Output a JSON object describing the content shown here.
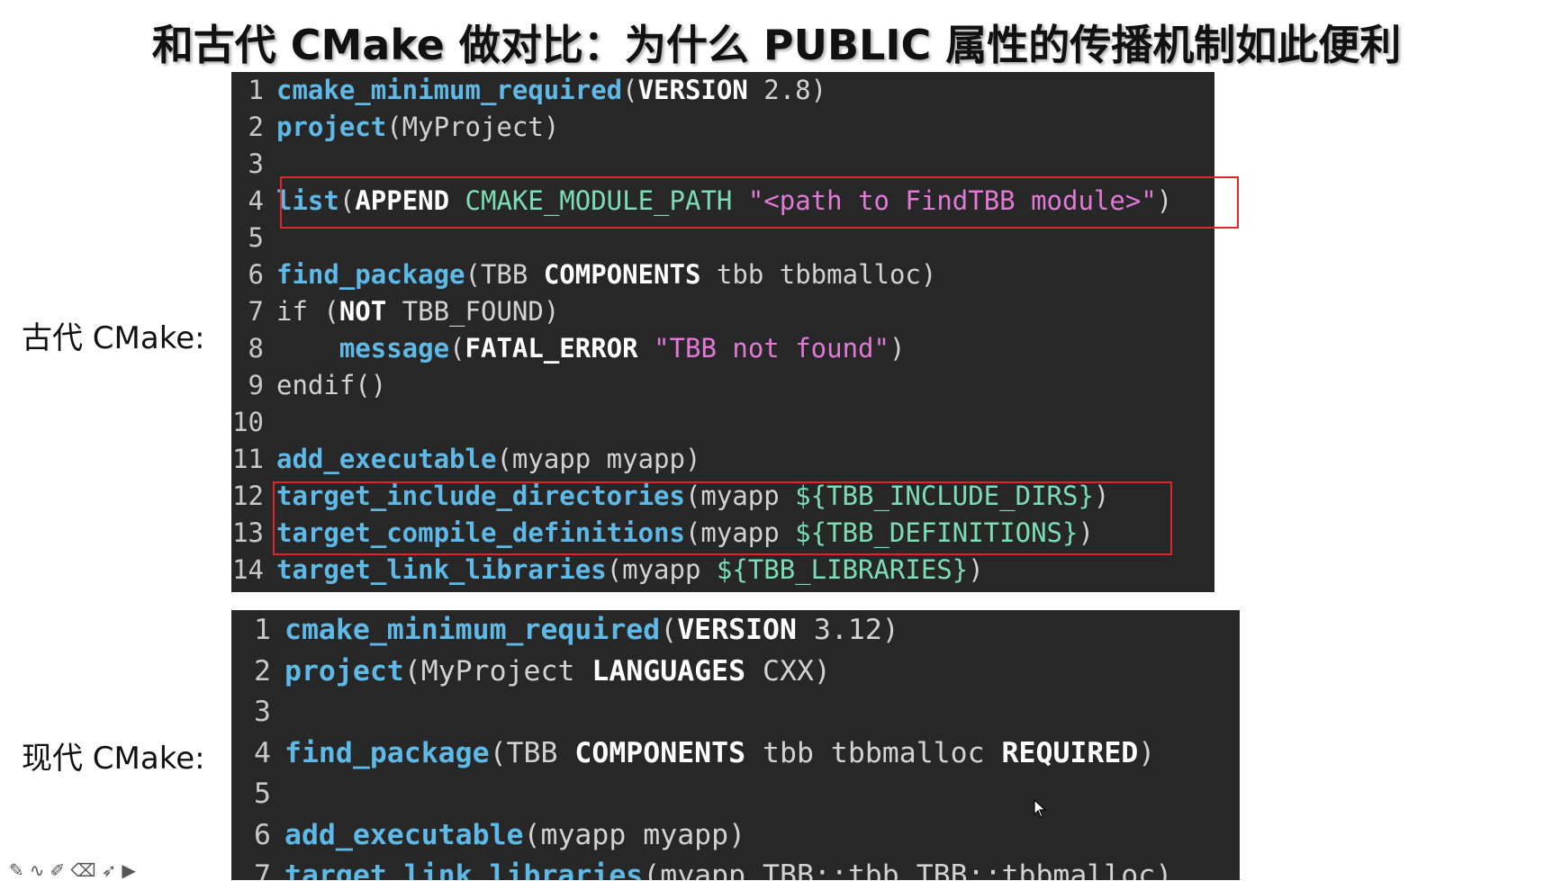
{
  "slide": {
    "title": "和古代 CMake 做对比：为什么 PUBLIC 属性的传播机制如此便利",
    "label_old": "古代 CMake:",
    "label_new": "现代 CMake:"
  },
  "code_old": [
    {
      "n": "1",
      "tokens": [
        {
          "t": "cmake_minimum_required",
          "c": "kw"
        },
        {
          "t": "("
        },
        {
          "t": "VERSION",
          "c": "bold"
        },
        {
          "t": " 2.8)"
        }
      ]
    },
    {
      "n": "2",
      "tokens": [
        {
          "t": "project",
          "c": "kw"
        },
        {
          "t": "(MyProject)"
        }
      ]
    },
    {
      "n": "3",
      "tokens": []
    },
    {
      "n": "4",
      "tokens": [
        {
          "t": "list",
          "c": "kw"
        },
        {
          "t": "("
        },
        {
          "t": "APPEND",
          "c": "bold"
        },
        {
          "t": " "
        },
        {
          "t": "CMAKE_MODULE_PATH",
          "c": "var"
        },
        {
          "t": " "
        },
        {
          "t": "\"<path to FindTBB module>\"",
          "c": "str"
        },
        {
          "t": ")"
        }
      ]
    },
    {
      "n": "5",
      "tokens": []
    },
    {
      "n": "6",
      "tokens": [
        {
          "t": "find_package",
          "c": "kw"
        },
        {
          "t": "(TBB "
        },
        {
          "t": "COMPONENTS",
          "c": "bold"
        },
        {
          "t": " tbb tbbmalloc)"
        }
      ]
    },
    {
      "n": "7",
      "tokens": [
        {
          "t": "if ("
        },
        {
          "t": "NOT",
          "c": "bold"
        },
        {
          "t": " TBB_FOUND)"
        }
      ]
    },
    {
      "n": "8",
      "tokens": [
        {
          "t": "    "
        },
        {
          "t": "message",
          "c": "kw"
        },
        {
          "t": "("
        },
        {
          "t": "FATAL_ERROR",
          "c": "bold"
        },
        {
          "t": " "
        },
        {
          "t": "\"TBB not found\"",
          "c": "str"
        },
        {
          "t": ")"
        }
      ]
    },
    {
      "n": "9",
      "tokens": [
        {
          "t": "endif()"
        }
      ]
    },
    {
      "n": "10",
      "tokens": []
    },
    {
      "n": "11",
      "tokens": [
        {
          "t": "add_executable",
          "c": "kw"
        },
        {
          "t": "(myapp myapp)"
        }
      ]
    },
    {
      "n": "12",
      "tokens": [
        {
          "t": "target_include_directories",
          "c": "kw"
        },
        {
          "t": "(myapp "
        },
        {
          "t": "${TBB_INCLUDE_DIRS}",
          "c": "var"
        },
        {
          "t": ")"
        }
      ]
    },
    {
      "n": "13",
      "tokens": [
        {
          "t": "target_compile_definitions",
          "c": "kw"
        },
        {
          "t": "(myapp "
        },
        {
          "t": "${TBB_DEFINITIONS}",
          "c": "var"
        },
        {
          "t": ")"
        }
      ]
    },
    {
      "n": "14",
      "tokens": [
        {
          "t": "target_link_libraries",
          "c": "kw"
        },
        {
          "t": "(myapp "
        },
        {
          "t": "${TBB_LIBRARIES}",
          "c": "var"
        },
        {
          "t": ")"
        }
      ]
    }
  ],
  "code_new": [
    {
      "n": "1",
      "tokens": [
        {
          "t": "cmake_minimum_required",
          "c": "kw"
        },
        {
          "t": "("
        },
        {
          "t": "VERSION",
          "c": "bold"
        },
        {
          "t": " 3.12)"
        }
      ]
    },
    {
      "n": "2",
      "tokens": [
        {
          "t": "project",
          "c": "kw"
        },
        {
          "t": "(MyProject "
        },
        {
          "t": "LANGUAGES",
          "c": "bold"
        },
        {
          "t": " CXX)"
        }
      ]
    },
    {
      "n": "3",
      "tokens": []
    },
    {
      "n": "4",
      "tokens": [
        {
          "t": "find_package",
          "c": "kw"
        },
        {
          "t": "(TBB "
        },
        {
          "t": "COMPONENTS",
          "c": "bold"
        },
        {
          "t": " tbb tbbmalloc "
        },
        {
          "t": "REQUIRED",
          "c": "bold"
        },
        {
          "t": ")"
        }
      ]
    },
    {
      "n": "5",
      "tokens": []
    },
    {
      "n": "6",
      "tokens": [
        {
          "t": "add_executable",
          "c": "kw"
        },
        {
          "t": "(myapp myapp)"
        }
      ]
    },
    {
      "n": "7",
      "tokens": [
        {
          "t": "target_link_libraries",
          "c": "kw"
        },
        {
          "t": "(myapp TBB::tbb TBB::tbbmalloc)"
        }
      ]
    }
  ],
  "colors": {
    "code_bg": "#272727",
    "keyword": "#5fb9e6",
    "string": "#e17ad6",
    "variable": "#7cdcb8",
    "highlight_box": "#e0262a"
  },
  "toolbar_icons": [
    "pen-icon",
    "curve-icon",
    "highlighter-icon",
    "eraser-icon",
    "pointer-icon",
    "camera-icon"
  ]
}
